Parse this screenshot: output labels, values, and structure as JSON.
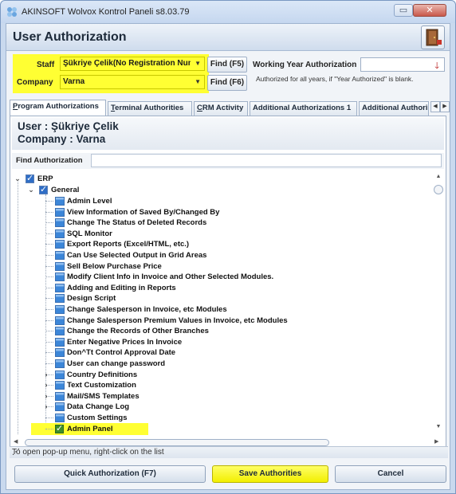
{
  "window": {
    "title": "AKINSOFT Wolvox Kontrol Paneli s8.03.79",
    "min_glyph": "▭",
    "close_glyph": "✕"
  },
  "header": {
    "title": "User Authorization",
    "exit_icon": "exit-door-icon"
  },
  "form": {
    "staff_label": "Staff",
    "staff_value": "Şükriye Çelik(No Registration Num",
    "company_label": "Company",
    "company_value": "Varna",
    "find_staff_label": "Find (F5)",
    "find_company_label": "Find (F6)",
    "working_year_label": "Working Year Authorization",
    "working_year_value": "",
    "working_year_note": "Authorized for all years, if \"Year Authorized\" is blank.",
    "highlight_color": "#ffff33"
  },
  "tabs": [
    {
      "label": "Program Authorizations",
      "active": true
    },
    {
      "label": "Terminal Authorities",
      "active": false
    },
    {
      "label": "CRM Activity",
      "active": false
    },
    {
      "label": "Additional Authorizations 1",
      "active": false
    },
    {
      "label": "Additional Authori",
      "active": false
    }
  ],
  "panel": {
    "user_line": "User : Şükriye Çelik",
    "company_line": "Company : Varna",
    "find_auth_label": "Find Authorization",
    "find_auth_value": ""
  },
  "tree": {
    "root": "ERP",
    "group": "General",
    "items": [
      {
        "label": "Admin Level",
        "expandable": false,
        "checked": false
      },
      {
        "label": "View Information of Saved By/Changed By",
        "expandable": false,
        "checked": false
      },
      {
        "label": "Change The Status of Deleted Records",
        "expandable": false,
        "checked": false
      },
      {
        "label": "SQL Monitor",
        "expandable": false,
        "checked": false
      },
      {
        "label": "Export Reports (Excel/HTML, etc.)",
        "expandable": false,
        "checked": false
      },
      {
        "label": "Can Use Selected Output in Grid Areas",
        "expandable": false,
        "checked": false
      },
      {
        "label": "Sell Below Purchase Price",
        "expandable": false,
        "checked": false
      },
      {
        "label": "Modify Client Info in Invoice and Other Selected Modules.",
        "expandable": false,
        "checked": false
      },
      {
        "label": "Adding and Editing in Reports",
        "expandable": false,
        "checked": false
      },
      {
        "label": "Design Script",
        "expandable": false,
        "checked": false
      },
      {
        "label": "Change Salesperson in Invoice, etc Modules",
        "expandable": false,
        "checked": false
      },
      {
        "label": "Change Salesperson Premium Values in Invoice, etc Modules",
        "expandable": false,
        "checked": false
      },
      {
        "label": "Change the Records of Other Branches",
        "expandable": false,
        "checked": false
      },
      {
        "label": "Enter Negative Prices In Invoice",
        "expandable": false,
        "checked": false
      },
      {
        "label": "Don^Tt Control Approval Date",
        "expandable": false,
        "checked": false
      },
      {
        "label": "User can change password",
        "expandable": false,
        "checked": false
      },
      {
        "label": "Country Definitions",
        "expandable": true,
        "checked": false
      },
      {
        "label": "Text Customization",
        "expandable": true,
        "checked": false
      },
      {
        "label": "Mail/SMS Templates",
        "expandable": true,
        "checked": false
      },
      {
        "label": "Data Change Log",
        "expandable": true,
        "checked": false
      },
      {
        "label": "Custom Settings",
        "expandable": false,
        "checked": false
      },
      {
        "label": "Admin Panel",
        "expandable": false,
        "checked": true,
        "highlighted": true
      }
    ]
  },
  "statusbar": {
    "text": "To open pop-up menu, right-click on the list"
  },
  "buttons": {
    "quick": "Quick Authorization (F7)",
    "save": "Save Authorities",
    "cancel": "Cancel"
  },
  "colors": {
    "accent_yellow": "#ffff33",
    "checkbox_blue": "#2f6ec6",
    "checkbox_green": "#3e8f2a"
  }
}
